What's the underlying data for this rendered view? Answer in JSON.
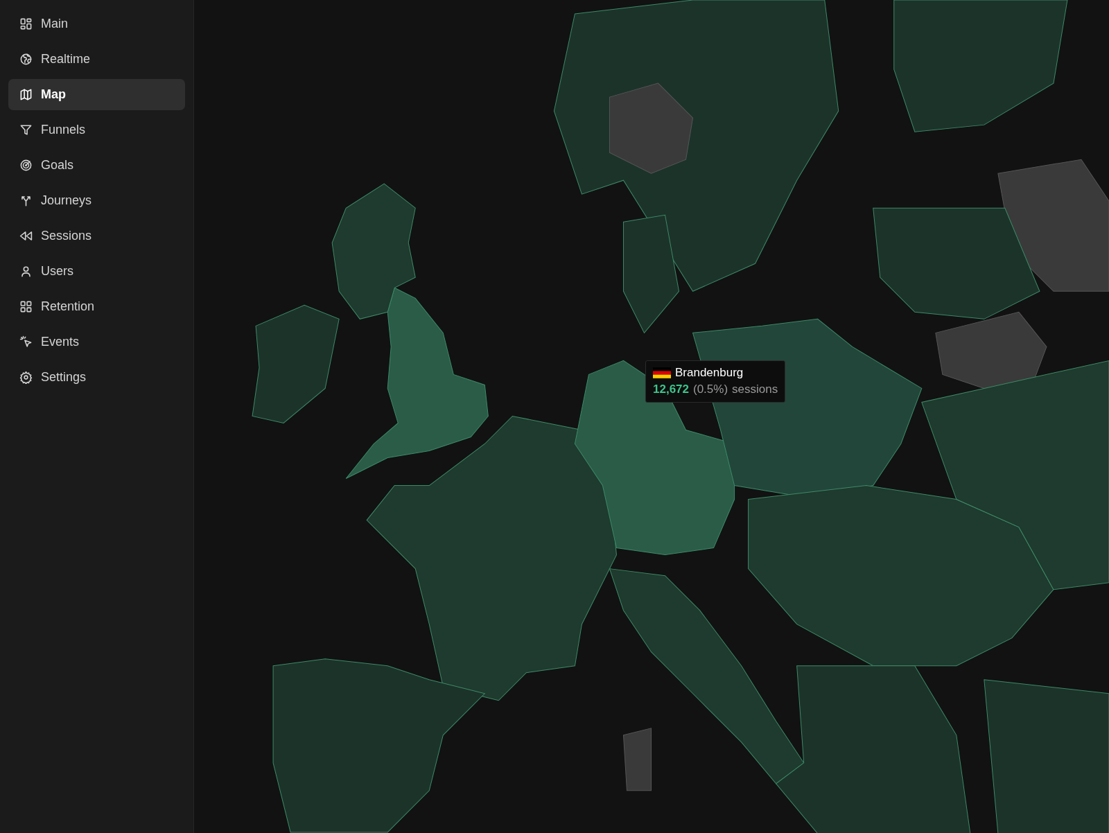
{
  "sidebar": {
    "items": [
      {
        "label": "Main",
        "selected": false
      },
      {
        "label": "Realtime",
        "selected": false
      },
      {
        "label": "Map",
        "selected": true
      },
      {
        "label": "Funnels",
        "selected": false
      },
      {
        "label": "Goals",
        "selected": false
      },
      {
        "label": "Journeys",
        "selected": false
      },
      {
        "label": "Sessions",
        "selected": false
      },
      {
        "label": "Users",
        "selected": false
      },
      {
        "label": "Retention",
        "selected": false
      },
      {
        "label": "Events",
        "selected": false
      },
      {
        "label": "Settings",
        "selected": false
      }
    ]
  },
  "tooltip": {
    "region": "Brandenburg",
    "sessions": "12,672",
    "share": "(0.5%)",
    "unit": "sessions"
  }
}
